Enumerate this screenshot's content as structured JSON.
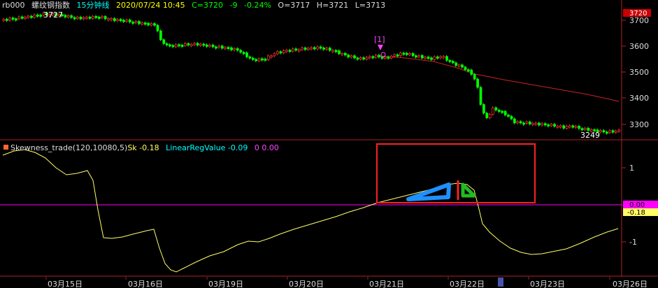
{
  "header": {
    "symbol": "rb000",
    "name": "螺纹钢指数",
    "period": "15分钟线",
    "datetime": "2020/07/24 10:45",
    "close": "C=3720",
    "change": "-9",
    "change_pct": "-0.24%",
    "open": "O=3717",
    "high": "H=3721",
    "low": "L=3713"
  },
  "price_pane": {
    "high_mark": "3727",
    "low_mark": "3249",
    "signal_marker": "[1]",
    "current_price_tag": "3720",
    "axis_labels": [
      "3700",
      "3600",
      "3500",
      "3400",
      "3300"
    ]
  },
  "indicator_pane": {
    "title": "Skewness_trade(120,10080,5)",
    "sk_label": "Sk",
    "sk_value": "-0.18",
    "linreg_label": "LinearRegValue",
    "linreg_value": "-0.09",
    "extra_label": "0",
    "extra_value": "0.00",
    "axis_labels": [
      "1",
      "-1"
    ],
    "zero_tag": "0.00",
    "value_tag": "-0.18"
  },
  "x_axis": {
    "dates": [
      "03月15日",
      "03月16日",
      "03月19日",
      "03月20日",
      "03月21日",
      "03月22日",
      "03月23日",
      "03月26日"
    ]
  },
  "colors": {
    "background": "#000000",
    "up": "#ff3333",
    "down": "#00ff00",
    "ma": "#cc2222",
    "sk_line": "#ffff66",
    "zero_line": "#ff00ff",
    "linreg_text": "#00ffff",
    "header_date": "#ffff00",
    "highlight_box": "#ff2020",
    "annotation_blue": "#1e90ff",
    "annotation_green": "#22bb22"
  },
  "chart_data": [
    {
      "type": "candlestick",
      "ylim": [
        3240,
        3740
      ],
      "x": [
        "03月15日",
        "03月16日",
        "03月19日",
        "03月20日",
        "03月21日",
        "03月22日",
        "03月23日",
        "03月26日"
      ],
      "approx_close": [
        3705,
        3690,
        3595,
        3600,
        3570,
        3510,
        3290,
        3280
      ],
      "high_label": 3727,
      "low_label": 3249
    },
    {
      "type": "line",
      "ylim": [
        -1.5,
        1.7
      ],
      "x": [
        "03月15日",
        "03月16日",
        "03月19日",
        "03月20日",
        "03月21日",
        "03月22日",
        "03月23日",
        "03月26日"
      ],
      "series": [
        {
          "name": "Sk",
          "values": [
            1.25,
            -0.85,
            -1.7,
            -0.9,
            -0.4,
            0.5,
            -1.3,
            -0.65
          ]
        },
        {
          "name": "0",
          "values": [
            0,
            0,
            0,
            0,
            0,
            0,
            0,
            0
          ]
        }
      ]
    }
  ]
}
